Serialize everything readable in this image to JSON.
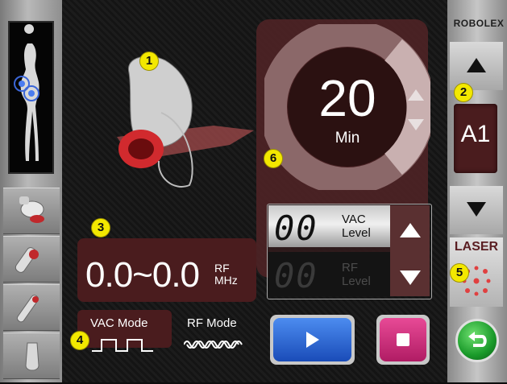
{
  "brand": "ROBOLEX",
  "callouts": [
    "1",
    "2",
    "3",
    "4",
    "5",
    "6"
  ],
  "timer": {
    "value": "20",
    "unit": "Min"
  },
  "treatment_level": {
    "value": "A1"
  },
  "vac": {
    "value": "00",
    "label_line1": "VAC",
    "label_line2": "Level"
  },
  "rf": {
    "value": "00",
    "label_line1": "RF",
    "label_line2": "Level"
  },
  "rf_range": {
    "value": "0.0~0.0",
    "unit_line1": "RF",
    "unit_line2": "MHz"
  },
  "modes": {
    "vac": "VAC Mode",
    "rf": "RF Mode"
  },
  "laser": {
    "label": "LASER"
  },
  "colors": {
    "accent_red": "#4a1c1e",
    "play_blue": "#2a6ad8",
    "stop_pink": "#d0307a",
    "back_green": "#1aa030",
    "badge_yellow": "#f3e800"
  },
  "icons": {
    "timer_up": "triangle-up-icon",
    "timer_down": "triangle-down-icon",
    "level_up": "triangle-up-icon",
    "level_down": "triangle-down-icon",
    "play": "play-icon",
    "stop": "stop-icon",
    "back": "back-arrow-icon"
  }
}
